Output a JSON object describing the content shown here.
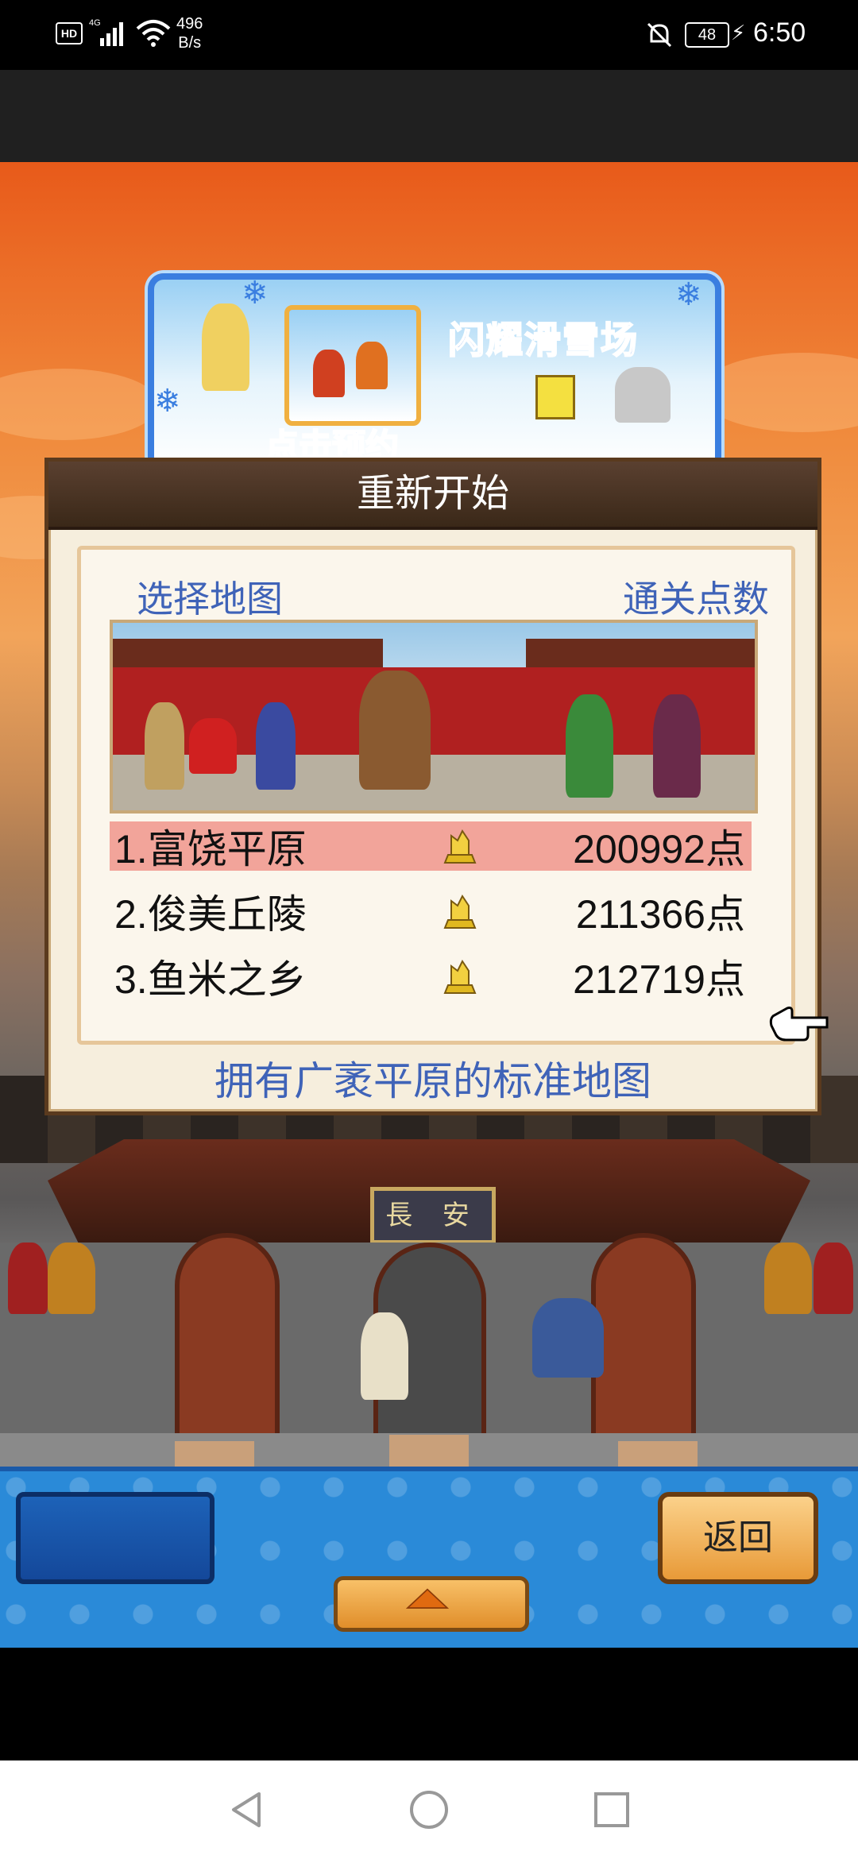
{
  "status_bar": {
    "hd": "HD",
    "network": "4G",
    "speed_value": "496",
    "speed_unit": "B/s",
    "battery": "48",
    "time": "6:50"
  },
  "promo": {
    "title": "闪耀滑雪场",
    "cta": "点击预约"
  },
  "scene": {
    "gate_plaque": "長 安"
  },
  "dialog": {
    "title": "重新开始",
    "col_map": "选择地图",
    "col_points": "通关点数",
    "maps": [
      {
        "name": "1.富饶平原",
        "points": "200992点",
        "selected": true
      },
      {
        "name": "2.俊美丘陵",
        "points": "211366点",
        "selected": false
      },
      {
        "name": "3.鱼米之乡",
        "points": "212719点",
        "selected": false
      }
    ],
    "description": "拥有广袤平原的标准地图"
  },
  "controls": {
    "back_label": "返回"
  }
}
